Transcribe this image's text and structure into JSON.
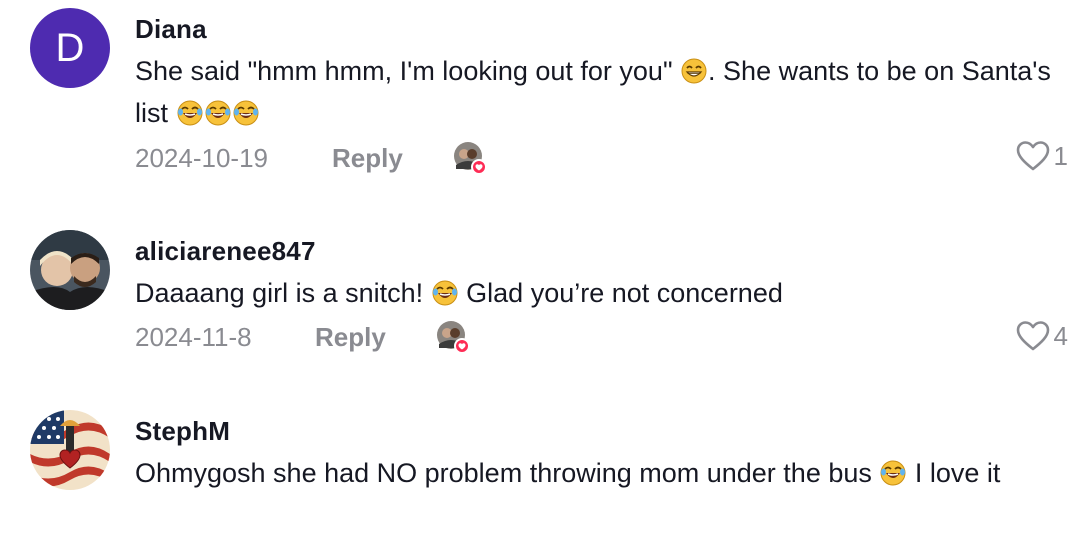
{
  "comments": [
    {
      "avatar_letter": "D",
      "username": "Diana",
      "text_parts": [
        "She said \"hmm hmm, I'm looking out for you\" ",
        ". She wants to be on Santa's list "
      ],
      "date": "2024-10-19",
      "reply_label": "Reply",
      "likes": "1"
    },
    {
      "username": "aliciarenee847",
      "text_parts": [
        "Daaaang girl is a snitch! ",
        " Glad you’re not concerned"
      ],
      "date": "2024-11-8",
      "reply_label": "Reply",
      "likes": "4"
    },
    {
      "username": "StephM",
      "text_parts": [
        "Ohmygosh she had NO problem throwing mom under the bus ",
        " I love it"
      ]
    }
  ],
  "icons": {
    "like": "heart-outline-icon",
    "creator_liked": "creator-liked-badge-icon",
    "emoji_grin": "grinning-face-icon",
    "emoji_laugh": "tears-of-joy-icon"
  },
  "colors": {
    "avatar_letter_bg": "#4e2bb0",
    "meta_text": "#8a8b91",
    "heart_badge": "#fe2c55"
  }
}
